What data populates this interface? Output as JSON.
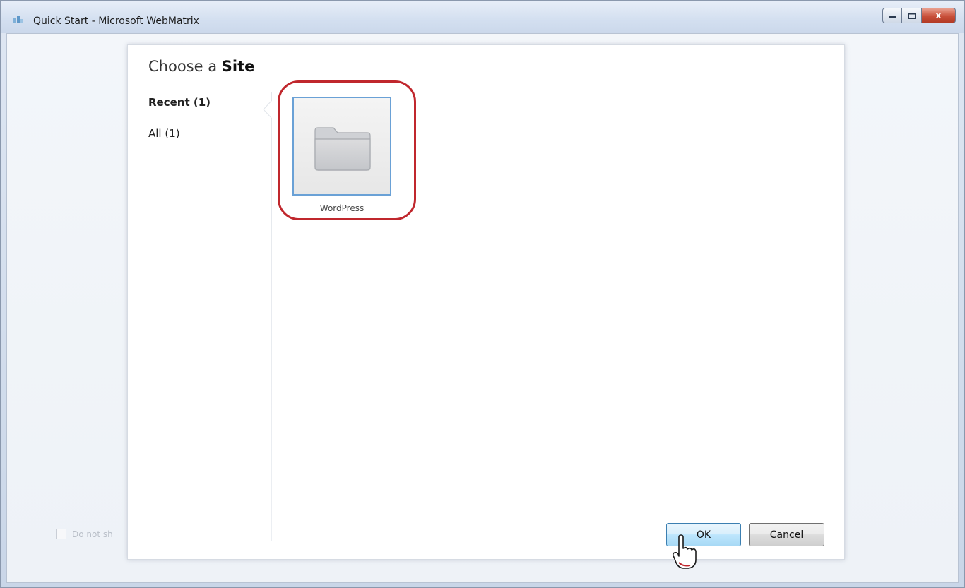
{
  "window": {
    "title": "Quick Start - Microsoft WebMatrix",
    "controls": {
      "minimize_icon": "minimize-icon",
      "maximize_icon": "maximize-icon",
      "close_label": "x"
    }
  },
  "dialog": {
    "heading_light": "Choose a",
    "heading_bold": "Site",
    "nav": [
      {
        "label": "Recent (1)",
        "active": true
      },
      {
        "label": "All (1)",
        "active": false
      }
    ],
    "sites": [
      {
        "label": "WordPress",
        "icon": "folder-icon",
        "selected": true
      }
    ],
    "buttons": {
      "ok": "OK",
      "cancel": "Cancel"
    }
  },
  "background": {
    "checkbox_label": "Do not sh"
  },
  "colors": {
    "highlight_ring": "#c0272d",
    "tile_selected_border": "#6aa1d6",
    "ok_button_border": "#3c7fb1"
  }
}
